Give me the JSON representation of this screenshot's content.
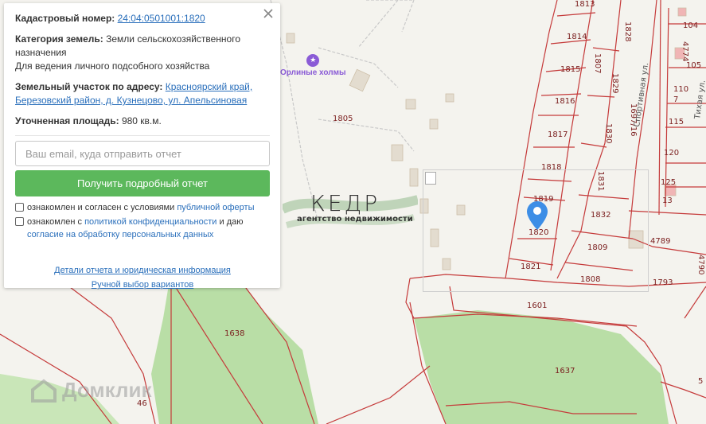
{
  "panel": {
    "cadastral_label": "Кадастровый номер:",
    "cadastral_number": "24:04:0501001:1820",
    "category_label": "Категория земель:",
    "category_value": "Земли сельскохозяйственного назначения",
    "usage_value": "Для ведения личного подсобного хозяйства",
    "address_label": "Земельный участок по адресу:",
    "address_value": "Красноярский край, Березовский район, д. Кузнецово, ул. Апельсиновая",
    "area_label": "Уточненная площадь:",
    "area_value": "980 кв.м.",
    "email_placeholder": "Ваш email, куда отправить отчет",
    "submit_label": "Получить подробный отчет",
    "consent1_text": "ознакомлен и согласен с условиями ",
    "consent1_link": "публичной оферты",
    "consent2_text": "ознакомлен с ",
    "consent2_link": "политикой конфиденциальности",
    "consent2_mid": " и даю",
    "consent2_link2": "согласие на обработку персональных данных",
    "details_link": "Детали отчета и юридическая информация",
    "manual_link": "Ручной выбор вариантов"
  },
  "map": {
    "poi_name": "Орлиные холмы",
    "watermark_title": "КЕДР",
    "watermark_subtitle": "агентство недвижимости",
    "brand_name": "Домклик",
    "streets": [
      "Спортивная ул.",
      "Тихая ул."
    ],
    "parcels": [
      "1813",
      "1814",
      "1815",
      "1816",
      "1817",
      "1818",
      "1819",
      "1820",
      "1821",
      "1807",
      "1828",
      "1829",
      "1830",
      "1831",
      "1832",
      "1809",
      "1808",
      "1793",
      "1601",
      "1637",
      "1638",
      "1805",
      "4789",
      "104",
      "105",
      "110",
      "115",
      "120",
      "125",
      "13",
      "7",
      "4774",
      "4790",
      "1697/16",
      "46",
      "5"
    ],
    "colors": {
      "parcel_line": "#c53a3a",
      "forest": "#b9dea6",
      "panel_button": "#5cb85c",
      "link": "#2a6fbb"
    }
  }
}
